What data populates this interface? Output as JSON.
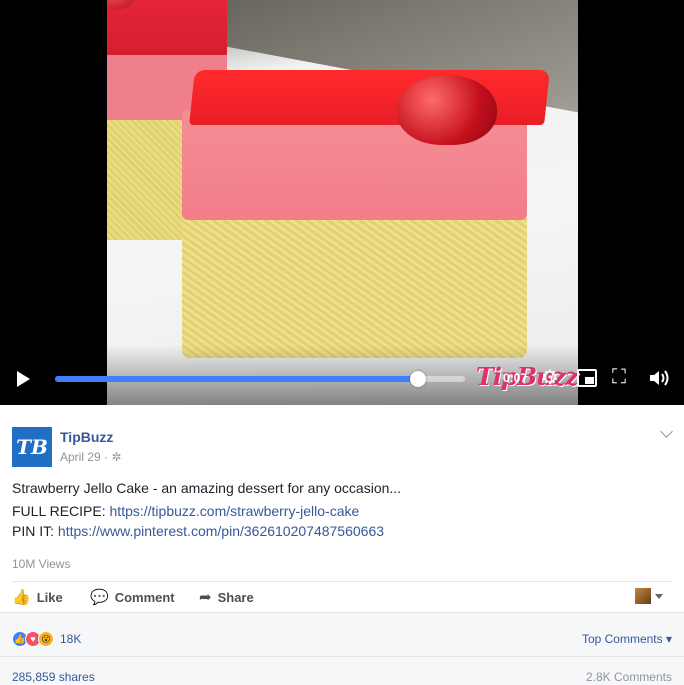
{
  "video": {
    "time": "0:07",
    "progress": 0.885,
    "watermark": "TipBuzz",
    "icons": [
      "play-icon",
      "gear-icon",
      "picture-in-picture-icon",
      "fullscreen-icon",
      "volume-icon"
    ]
  },
  "post": {
    "avatar_text": "TB",
    "page_name": "TipBuzz",
    "date": "April 29",
    "privacy_sep": "·",
    "caption": "Strawberry Jello Cake - an amazing dessert for any occasion...",
    "recipe_label": "FULL RECIPE: ",
    "recipe_url": "https://tipbuzz.com/strawberry-jello-cake",
    "pin_label": "PIN IT: ",
    "pin_url": "https://www.pinterest.com/pin/362610207487560663",
    "views": "10M Views"
  },
  "actions": {
    "like": "Like",
    "comment": "Comment",
    "share": "Share"
  },
  "reactions": {
    "count": "18K",
    "sort_label": "Top Comments",
    "shares": "285,859 shares",
    "comments": "2.8K Comments"
  },
  "colors": {
    "link": "#365899",
    "progress": "#4080ff",
    "brand": "#1f6fc4"
  }
}
